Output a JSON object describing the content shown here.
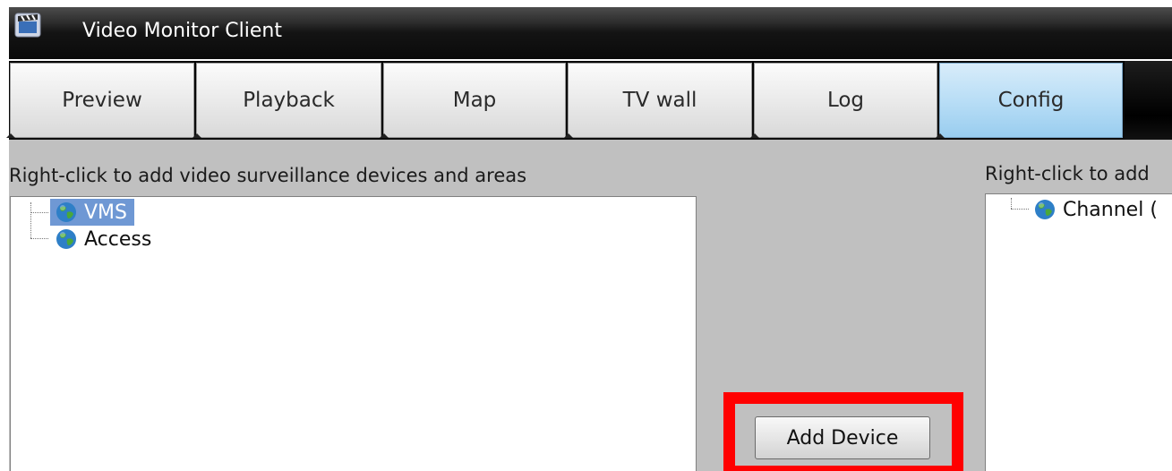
{
  "window": {
    "title": "Video Monitor Client",
    "icon": "app-clapper-icon"
  },
  "tabs": [
    {
      "label": "Preview",
      "active": false
    },
    {
      "label": "Playback",
      "active": false
    },
    {
      "label": "Map",
      "active": false
    },
    {
      "label": "TV wall",
      "active": false
    },
    {
      "label": "Log",
      "active": false
    },
    {
      "label": "Config",
      "active": true
    }
  ],
  "left_panel": {
    "hint": "Right-click to add video surveillance devices and areas",
    "tree": [
      {
        "label": "VMS",
        "icon": "globe-icon",
        "selected": true
      },
      {
        "label": "Access",
        "icon": "globe-icon",
        "selected": false
      }
    ]
  },
  "actions": {
    "add_device_label": "Add Device",
    "highlight_color": "#ff0000"
  },
  "right_panel": {
    "hint": "Right-click to add",
    "tree": [
      {
        "label": "Channel (",
        "icon": "globe-icon"
      }
    ]
  },
  "colors": {
    "active_tab": "#b9def6",
    "selection": "#6f98d4",
    "panel_bg": "#c0c0c0"
  }
}
